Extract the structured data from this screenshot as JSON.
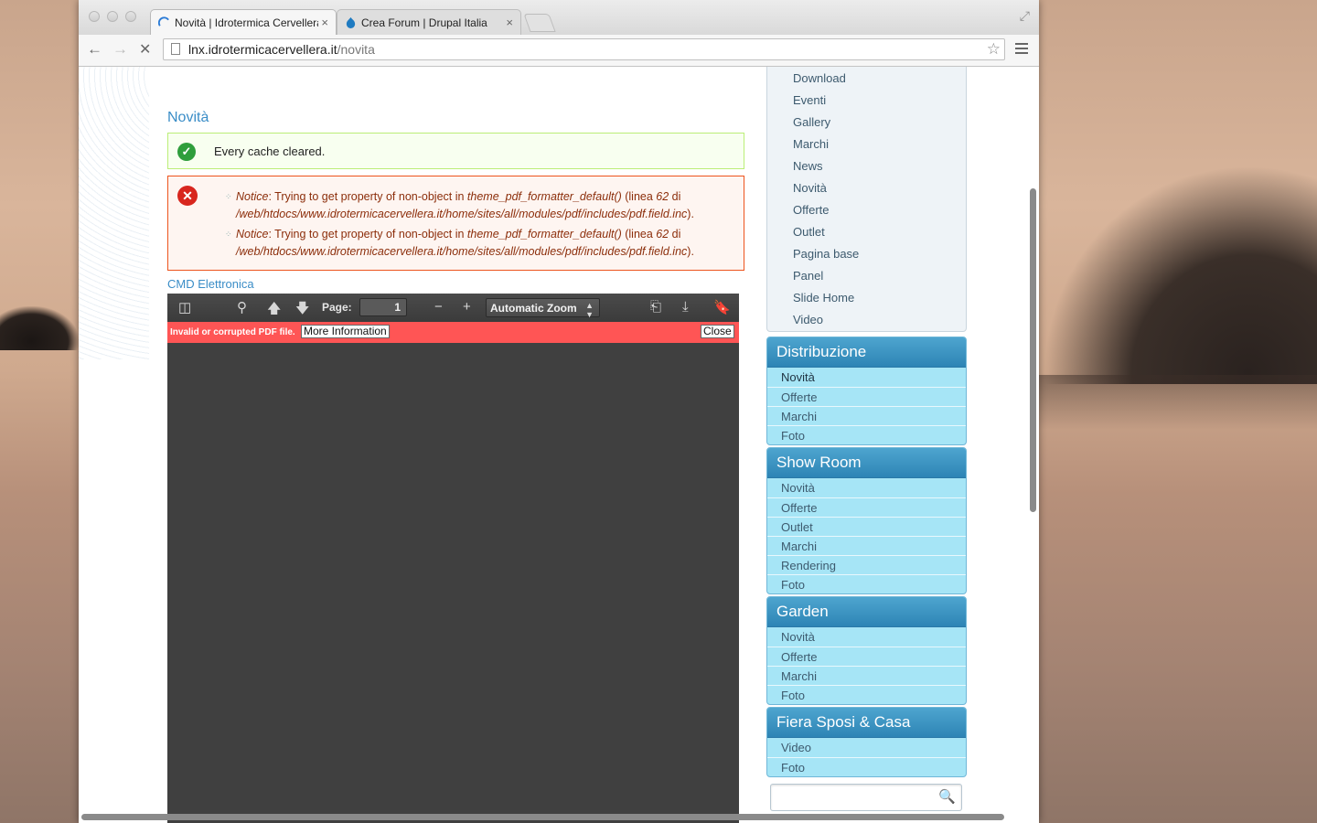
{
  "browser": {
    "tabs": [
      {
        "title": "Novità | Idrotermica Cervellera",
        "active": true
      },
      {
        "title": "Crea Forum | Drupal Italia",
        "active": false
      }
    ],
    "url_host": "lnx.idrotermicacervellera.it",
    "url_path": "/novita"
  },
  "page": {
    "title": "Novità",
    "status_message": "Every cache cleared.",
    "errors": [
      {
        "label": "Notice",
        "text1": ": Trying to get property of non-object in ",
        "func": "theme_pdf_formatter_default()",
        "text2": " (linea ",
        "line": "62",
        "text3": " di",
        "file": "/web/htdocs/www.idrotermicacervellera.it/home/sites/all/modules/pdf/includes/pdf.field.inc",
        "end": ")."
      },
      {
        "label": "Notice",
        "text1": ": Trying to get property of non-object in ",
        "func": "theme_pdf_formatter_default()",
        "text2": " (linea ",
        "line": "62",
        "text3": " di",
        "file": "/web/htdocs/www.idrotermicacervellera.it/home/sites/all/modules/pdf/includes/pdf.field.inc",
        "end": ")."
      }
    ],
    "field_label": "CMD Elettronica"
  },
  "pdf_viewer": {
    "page_label": "Page:",
    "page_value": "1",
    "zoom": "Automatic Zoom",
    "error_text": "Invalid or corrupted PDF file.",
    "more_info": "More Information",
    "close": "Close"
  },
  "sidebar": {
    "menu_items": [
      "Download",
      "Eventi",
      "Gallery",
      "Marchi",
      "News",
      "Novità",
      "Offerte",
      "Outlet",
      "Pagina base",
      "Panel",
      "Slide Home",
      "Video"
    ],
    "blocks": [
      {
        "title": "Distribuzione",
        "items": [
          "Novità",
          "Offerte",
          "Marchi",
          "Foto"
        ]
      },
      {
        "title": "Show Room",
        "items": [
          "Novità",
          "Offerte",
          "Outlet",
          "Marchi",
          "Rendering",
          "Foto"
        ]
      },
      {
        "title": "Garden",
        "items": [
          "Novità",
          "Offerte",
          "Marchi",
          "Foto"
        ]
      },
      {
        "title": "Fiera Sposi & Casa",
        "items": [
          "Video",
          "Foto"
        ]
      }
    ],
    "search_value": ""
  }
}
